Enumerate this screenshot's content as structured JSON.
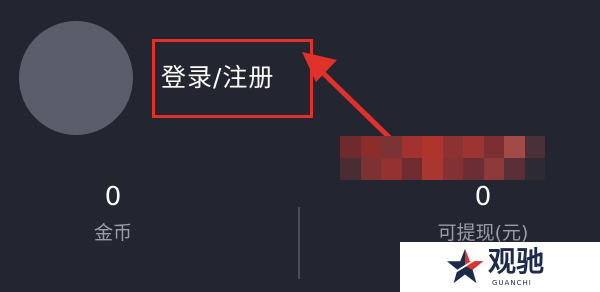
{
  "profile": {
    "login_label": "登录/注册"
  },
  "stats": {
    "coins": {
      "value": "0",
      "label": "金币"
    },
    "cash": {
      "value": "0",
      "label": "可提现(元)"
    }
  },
  "watermark": {
    "brand": "观驰",
    "sub": "GUANCHI"
  },
  "colors": {
    "background": "#232631",
    "annotation_red": "#e0312b",
    "avatar_placeholder": "#5a5e6b"
  }
}
